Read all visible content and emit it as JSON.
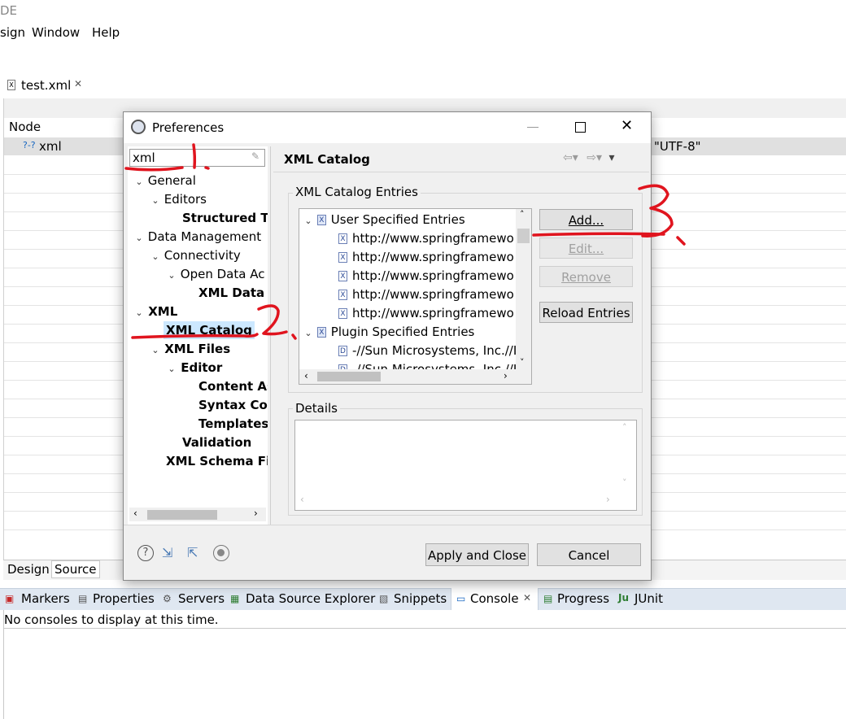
{
  "titlebar": {
    "app_title": "DE"
  },
  "menu": {
    "items": [
      {
        "label": "sign"
      },
      {
        "label": "Window"
      },
      {
        "label": "Help"
      }
    ]
  },
  "editor": {
    "tab_label": "test.xml",
    "columns": {
      "node": "Node"
    },
    "row": {
      "label": "xml",
      "value": "\"UTF-8\""
    },
    "bottom_tabs": {
      "design": "Design",
      "source": "Source"
    }
  },
  "views": {
    "tabs": [
      {
        "label": "Markers"
      },
      {
        "label": "Properties"
      },
      {
        "label": "Servers"
      },
      {
        "label": "Data Source Explorer"
      },
      {
        "label": "Snippets"
      },
      {
        "label": "Console"
      },
      {
        "label": "Progress"
      },
      {
        "label": "JUnit"
      }
    ],
    "console_message": "No consoles to display at this time."
  },
  "dialog": {
    "title": "Preferences",
    "filter_value": "xml",
    "tree": [
      {
        "label": "General"
      },
      {
        "label": "Editors"
      },
      {
        "label": "Structured Te"
      },
      {
        "label": "Data Management"
      },
      {
        "label": "Connectivity"
      },
      {
        "label": "Open Data Ac"
      },
      {
        "label": "XML Data S"
      },
      {
        "label": "XML"
      },
      {
        "label": "XML Catalog"
      },
      {
        "label": "XML Files"
      },
      {
        "label": "Editor"
      },
      {
        "label": "Content As"
      },
      {
        "label": "Syntax Col"
      },
      {
        "label": "Templates"
      },
      {
        "label": "Validation"
      },
      {
        "label": "XML Schema Fil"
      }
    ],
    "page_title": "XML Catalog",
    "entries_group": "XML Catalog Entries",
    "entries": {
      "user_root": "User Specified Entries",
      "user_items": [
        "http://www.springframewo",
        "http://www.springframewo",
        "http://www.springframewo",
        "http://www.springframewo",
        "http://www.springframewo"
      ],
      "plugin_root": "Plugin Specified Entries",
      "plugin_items": [
        "-//Sun Microsystems, Inc.//I",
        "-//Sun Microsystems, Inc.//I"
      ]
    },
    "buttons": {
      "add": "Add...",
      "edit": "Edit...",
      "remove": "Remove",
      "reload": "Reload Entries",
      "apply_close": "Apply and Close",
      "cancel": "Cancel"
    },
    "details_group": "Details"
  },
  "annotations": [
    "1.",
    "2.",
    "3."
  ],
  "colors": {
    "annotation_red": "#e0141e",
    "selection": "#cce8ff",
    "dialog_bg": "#f0f0f0"
  }
}
